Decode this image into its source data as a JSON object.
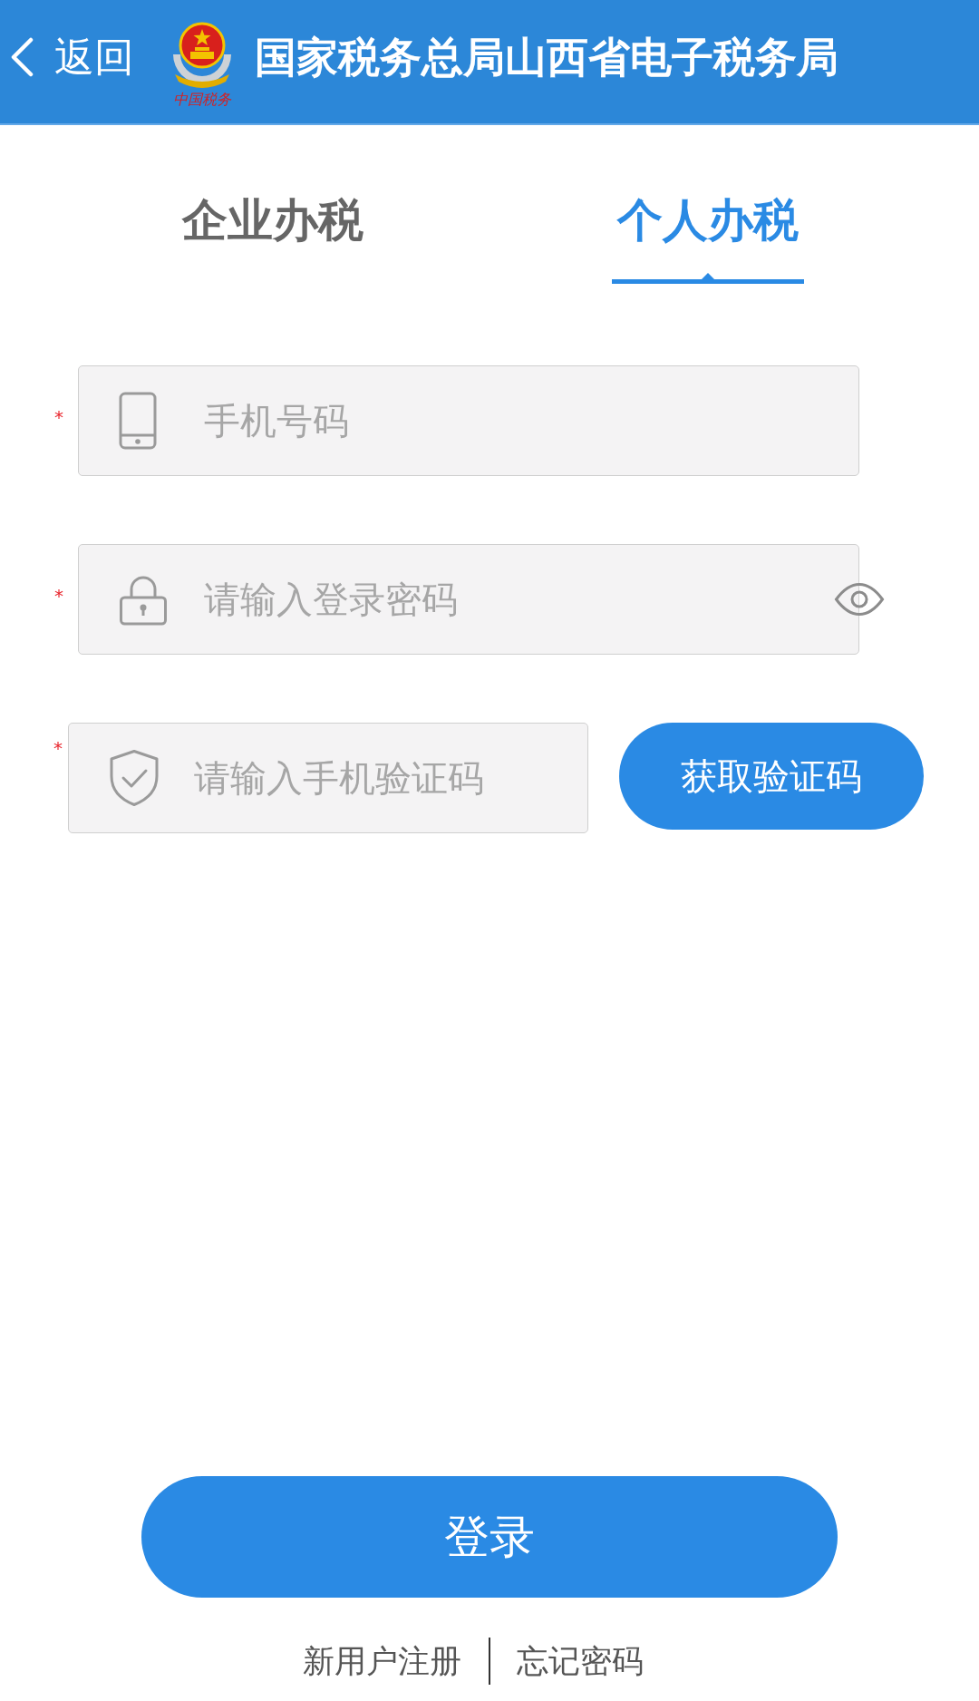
{
  "header": {
    "back": {
      "label": "返回"
    },
    "logo_caption": "中国税务",
    "title": "国家税务总局山西省电子税务局"
  },
  "tabs": [
    {
      "label": "企业办税",
      "selected": false
    },
    {
      "label": "个人办税",
      "selected": true
    }
  ],
  "fields": [
    {
      "kind": "phone",
      "required_mark": "*",
      "placeholder": "手机号码"
    },
    {
      "kind": "password",
      "required_mark": "*",
      "placeholder": "请输入登录密码"
    },
    {
      "kind": "code",
      "required_mark": "*",
      "placeholder": "请输入手机验证码",
      "action": "获取验证码"
    }
  ],
  "login_button": {
    "label": "登录"
  },
  "links": [
    "新用户注册",
    "忘记密码"
  ]
}
